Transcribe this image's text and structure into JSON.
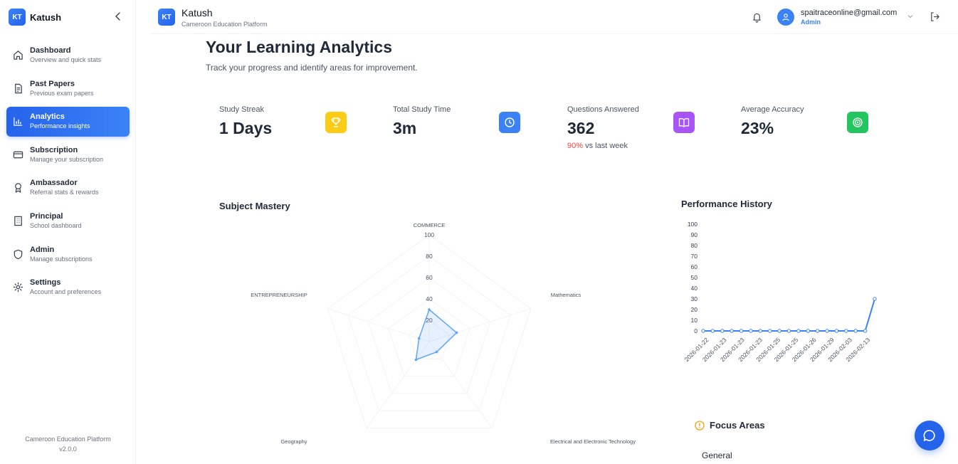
{
  "brand": {
    "logo_text": "KT",
    "name": "Katush",
    "subtitle": "Cameroon Education Platform"
  },
  "sidebar": {
    "items": [
      {
        "label": "Dashboard",
        "sub": "Overview and quick stats",
        "icon": "home-icon"
      },
      {
        "label": "Past Papers",
        "sub": "Previous exam papers",
        "icon": "document-icon"
      },
      {
        "label": "Analytics",
        "sub": "Performance insights",
        "icon": "bar-chart-icon",
        "active": true
      },
      {
        "label": "Subscription",
        "sub": "Manage your subscription",
        "icon": "credit-card-icon"
      },
      {
        "label": "Ambassador",
        "sub": "Referral stats & rewards",
        "icon": "award-icon"
      },
      {
        "label": "Principal",
        "sub": "School dashboard",
        "icon": "building-icon"
      },
      {
        "label": "Admin",
        "sub": "Manage subscriptions",
        "icon": "shield-icon"
      },
      {
        "label": "Settings",
        "sub": "Account and preferences",
        "icon": "gear-icon"
      }
    ],
    "footer_line1": "Cameroon Education Platform",
    "footer_line2": "v2.0.0"
  },
  "header": {
    "email": "spaitraceonline@gmail.com",
    "role": "Admin"
  },
  "main": {
    "title": "Your Learning Analytics",
    "subtitle": "Track your progress and identify areas for improvement.",
    "stats": [
      {
        "label": "Study Streak",
        "value": "1 Days",
        "icon": "trophy-icon",
        "color": "#facc15"
      },
      {
        "label": "Total Study Time",
        "value": "3m",
        "icon": "clock-icon",
        "color": "#3b82f6"
      },
      {
        "label": "Questions Answered",
        "value": "362",
        "icon": "book-icon",
        "color": "#a855f7",
        "trend_pct": "90%",
        "trend_text": "vs last week"
      },
      {
        "label": "Average Accuracy",
        "value": "23%",
        "icon": "target-icon",
        "color": "#22c55e"
      }
    ],
    "mastery_title": "Subject Mastery",
    "history_title": "Performance History",
    "focus_title": "Focus Areas",
    "focus_first": "General"
  },
  "chart_data": [
    {
      "type": "radar",
      "title": "Subject Mastery",
      "axes": [
        "COMMERCE",
        "Mathematics",
        "Electrical and Electronic Technology",
        "Geography",
        "ENTREPRENEURSHIP"
      ],
      "ticks": [
        20,
        40,
        60,
        80,
        100
      ],
      "range": [
        0,
        100
      ],
      "values": [
        30,
        27,
        12,
        21,
        10
      ]
    },
    {
      "type": "line",
      "title": "Performance History",
      "x": [
        "2026-01-22",
        "2026-01-22",
        "2026-01-23",
        "2026-01-23",
        "2026-01-23",
        "2026-01-23",
        "2026-01-23",
        "2026-01-25",
        "2026-01-25",
        "2026-01-25",
        "2026-01-26",
        "2026-01-26",
        "2026-01-29",
        "2026-01-29",
        "2026-02-03",
        "2026-02-03",
        "2026-02-13",
        "2026-02-13",
        "2026-02-13"
      ],
      "x_tick_labels": [
        "2026-01-22",
        "2026-01-23",
        "2026-01-23",
        "2026-01-23",
        "2026-01-25",
        "2026-01-25",
        "2026-01-26",
        "2026-01-29",
        "2026-02-03",
        "2026-02-13"
      ],
      "values": [
        0,
        0,
        0,
        0,
        0,
        0,
        0,
        0,
        0,
        0,
        0,
        0,
        0,
        0,
        0,
        0,
        0,
        0,
        30
      ],
      "ylim": [
        0,
        100
      ],
      "yticks": [
        0,
        10,
        20,
        30,
        40,
        50,
        60,
        70,
        80,
        90,
        100
      ],
      "color": "#3b82f6"
    }
  ]
}
